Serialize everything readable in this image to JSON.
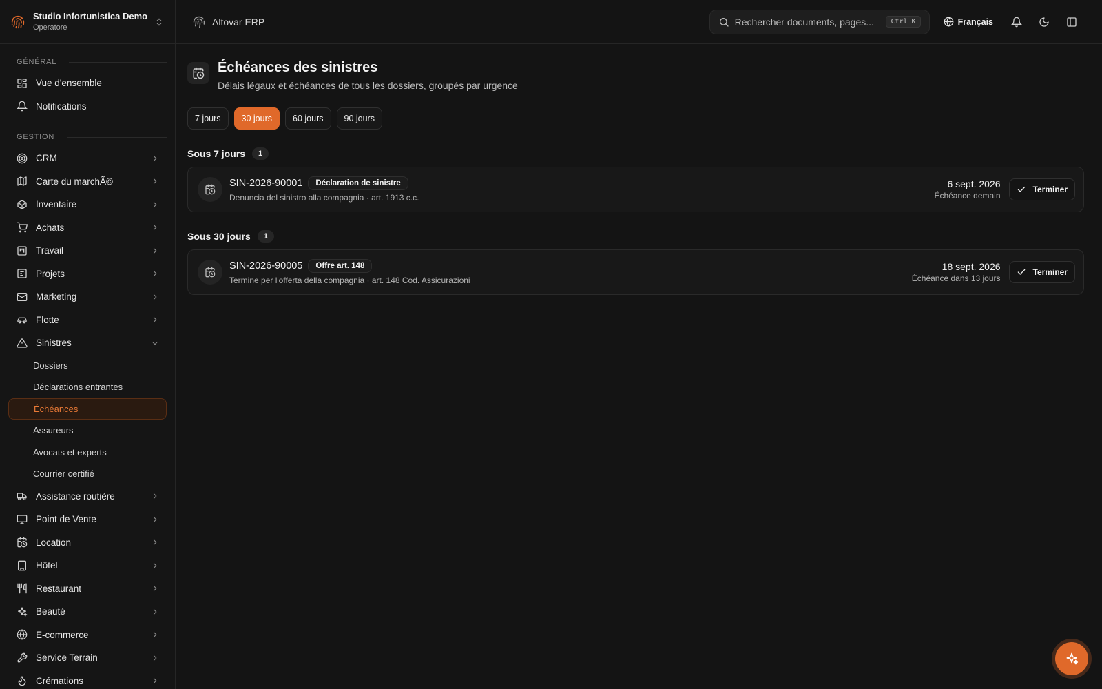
{
  "workspace": {
    "name": "Studio Infortunistica Demo",
    "role": "Operatore"
  },
  "sidebar": {
    "sections": [
      {
        "label": "GÉNÉRAL"
      },
      {
        "label": "GESTION"
      }
    ],
    "general_items": [
      {
        "label": "Vue d'ensemble",
        "icon": "dashboard-icon"
      },
      {
        "label": "Notifications",
        "icon": "bell-icon"
      }
    ],
    "items": [
      {
        "label": "CRM",
        "icon": "target-icon"
      },
      {
        "label": "Carte du marchÃ©",
        "icon": "map-icon"
      },
      {
        "label": "Inventaire",
        "icon": "package-icon"
      },
      {
        "label": "Achats",
        "icon": "cart-icon"
      },
      {
        "label": "Travail",
        "icon": "kanban-icon"
      },
      {
        "label": "Projets",
        "icon": "projects-icon"
      },
      {
        "label": "Marketing",
        "icon": "mail-icon"
      },
      {
        "label": "Flotte",
        "icon": "car-icon"
      },
      {
        "label": "Sinistres",
        "icon": "warning-icon"
      },
      {
        "label": "Assistance routière",
        "icon": "truck-icon"
      },
      {
        "label": "Point de Vente",
        "icon": "monitor-icon"
      },
      {
        "label": "Location",
        "icon": "calendar-clock-icon"
      },
      {
        "label": "Hôtel",
        "icon": "building-icon"
      },
      {
        "label": "Restaurant",
        "icon": "utensils-icon"
      },
      {
        "label": "Beauté",
        "icon": "sparkles-icon"
      },
      {
        "label": "E-commerce",
        "icon": "globe-icon"
      },
      {
        "label": "Service Terrain",
        "icon": "wrench-icon"
      },
      {
        "label": "Crémations",
        "icon": "flame-icon"
      }
    ],
    "sinistres_sub": [
      {
        "label": "Dossiers"
      },
      {
        "label": "Déclarations entrantes"
      },
      {
        "label": "Échéances",
        "active": true
      },
      {
        "label": "Assureurs"
      },
      {
        "label": "Avocats et experts"
      },
      {
        "label": "Courrier certifié"
      }
    ]
  },
  "topbar": {
    "brand": "Altovar ERP",
    "search_placeholder": "Rechercher documents, pages...",
    "shortcut": "Ctrl K",
    "language": "Français"
  },
  "page": {
    "title": "Échéances des sinistres",
    "subtitle": "Délais légaux et échéances de tous les dossiers, groupés par urgence"
  },
  "filters": [
    {
      "label": "7 jours",
      "active": false
    },
    {
      "label": "30 jours",
      "active": true
    },
    {
      "label": "60 jours",
      "active": false
    },
    {
      "label": "90 jours",
      "active": false
    }
  ],
  "groups": [
    {
      "title": "Sous 7 jours",
      "count": "1",
      "items": [
        {
          "id": "SIN-2026-90001",
          "tag": "Déclaration de sinistre",
          "description": "Denuncia del sinistro alla compagnia · art. 1913 c.c.",
          "date": "6 sept. 2026",
          "relative": "Échéance demain",
          "action": "Terminer"
        }
      ]
    },
    {
      "title": "Sous 30 jours",
      "count": "1",
      "items": [
        {
          "id": "SIN-2026-90005",
          "tag": "Offre art. 148",
          "description": "Termine per l'offerta della compagnia · art. 148 Cod. Assicurazioni",
          "date": "18 sept. 2026",
          "relative": "Échéance dans 13 jours",
          "action": "Terminer"
        }
      ]
    }
  ],
  "colors": {
    "accent": "#e0692a",
    "background": "#141414",
    "active_bg": "#2a1a10"
  }
}
